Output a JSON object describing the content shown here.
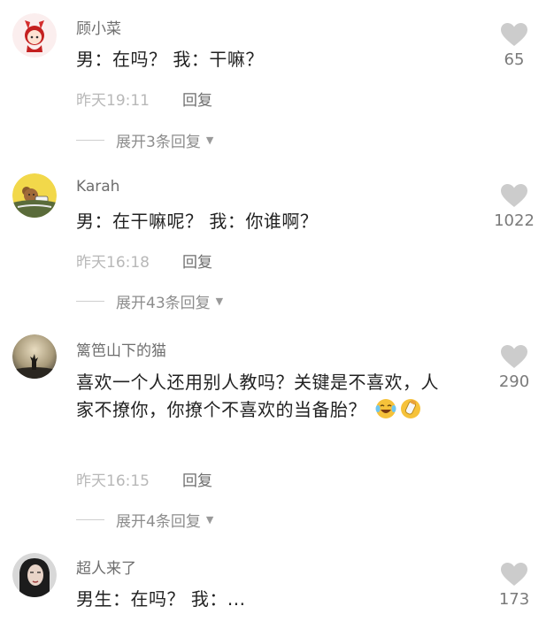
{
  "comments": [
    {
      "username": "顾小菜",
      "text": "男：在吗？ 我：干嘛？",
      "time": "昨天19:11",
      "reply_label": "回复",
      "expand_label": "展开3条回复",
      "likes": "65",
      "avatar_icon": "cartoon-girl-avatar-icon"
    },
    {
      "username": "Karah",
      "text": "男：在干嘛呢？ 我：你谁啊？",
      "time": "昨天16:18",
      "reply_label": "回复",
      "expand_label": "展开43条回复",
      "likes": "1022",
      "avatar_icon": "cartoon-bear-avatar-icon"
    },
    {
      "username": "篱笆山下的猫",
      "text": "喜欢一个人还用别人教吗？关键是不喜欢，人家不撩你，你撩个不喜欢的当备胎？",
      "time": "昨天16:15",
      "reply_label": "回复",
      "expand_label": "展开4条回复",
      "likes": "290",
      "avatar_icon": "silhouette-sunset-avatar-icon",
      "emojis": [
        "laughing-crying-emoji-icon",
        "bottle-emoji-icon"
      ]
    },
    {
      "username": "超人来了",
      "text": "男生：在吗？ 我：...",
      "likes": "173",
      "avatar_icon": "woman-portrait-avatar-icon"
    }
  ],
  "colors": {
    "text": "#222222",
    "username": "#6e6e6e",
    "meta": "#b8b8b8",
    "heart": "#cccccc"
  }
}
